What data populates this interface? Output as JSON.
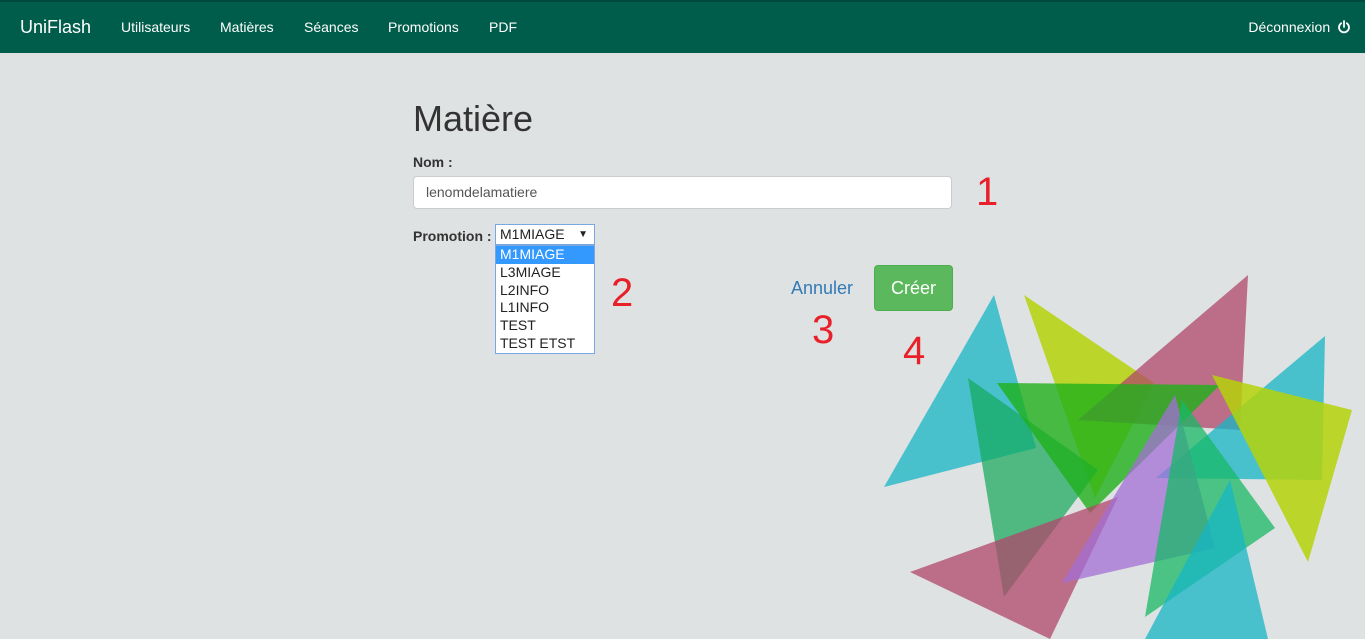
{
  "navbar": {
    "brand": "UniFlash",
    "items": [
      "Utilisateurs",
      "Matières",
      "Séances",
      "Promotions",
      "PDF"
    ],
    "logout_label": "Déconnexion"
  },
  "form": {
    "title": "Matière",
    "name_label": "Nom :",
    "name_value": "lenomdelamatiere",
    "promotion_label": "Promotion :",
    "promotion_selected": "M1MIAGE",
    "promotion_options": [
      "M1MIAGE",
      "L3MIAGE",
      "L2INFO",
      "L1INFO",
      "TEST",
      "TEST ETST"
    ],
    "cancel_label": "Annuler",
    "create_label": "Créer"
  },
  "annotations": [
    "1",
    "2",
    "3",
    "4"
  ],
  "colors": {
    "navbar": "#005c4b",
    "background": "#dfe2e2",
    "create_button": "#5cb85c",
    "link": "#337ab7",
    "annotation": "#e8202a"
  }
}
